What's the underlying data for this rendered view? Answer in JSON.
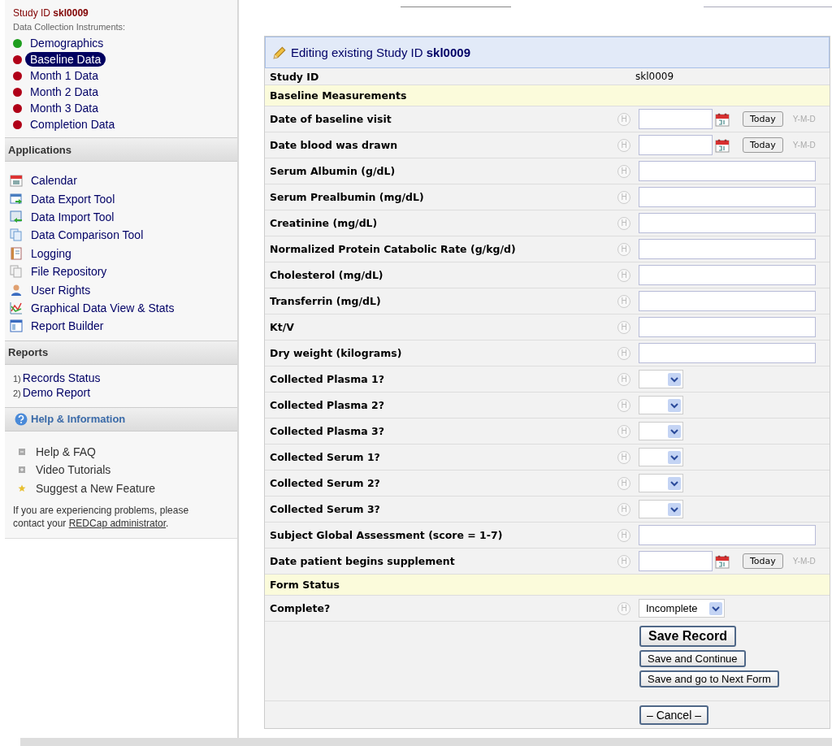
{
  "sidebar": {
    "study_id": "Study ID **skl0009**",
    "instruments_heading": "Data Collection Instruments:",
    "instruments": [
      {
        "label": "Demographics",
        "color": "#1e9e1e",
        "selected": false
      },
      {
        "label": "Baseline Data",
        "color": "#b00018",
        "selected": true
      },
      {
        "label": "Month 1 Data",
        "color": "#b00018",
        "selected": false
      },
      {
        "label": "Month 2 Data",
        "color": "#b00018",
        "selected": false
      },
      {
        "label": "Month 3 Data",
        "color": "#b00018",
        "selected": false
      },
      {
        "label": "Completion Data",
        "color": "#b00018",
        "selected": false
      }
    ],
    "applications": {
      "title": "Applications",
      "items": [
        "Calendar",
        "Data Export Tool",
        "Data Import Tool",
        "Data Comparison Tool",
        "Logging",
        "File Repository",
        "User Rights",
        "Graphical Data View & Stats",
        "Report Builder"
      ]
    },
    "reports": {
      "title": "Reports",
      "items": [
        {
          "number": "1)",
          "label": "Records Status"
        },
        {
          "number": "2)",
          "label": "Demo Report"
        }
      ]
    },
    "help": {
      "title": "Help & Information",
      "items": [
        "Help & FAQ",
        "Video Tutorials",
        "Suggest a New Feature"
      ],
      "note": "If you are experiencing problems, please contact your",
      "note_link": "REDCap administrator",
      "note_end": "."
    }
  },
  "form": {
    "title": "Editing existing Study ID **skl0009**",
    "study_id_label": "Study ID",
    "study_id_value": "skl0009",
    "sections": [
      {
        "title": "Baseline Measurements",
        "fields": [
          {
            "label": "Date of baseline visit",
            "kind": "date",
            "hint": "H",
            "button": "Today",
            "format": "Y-M-D"
          },
          {
            "label": "Date blood was drawn",
            "kind": "date",
            "hint": "H",
            "button": "Today",
            "format": "Y-M-D"
          },
          {
            "label": "Serum Albumin (g/dL)",
            "kind": "text",
            "hint": "H"
          },
          {
            "label": "Serum Prealbumin (mg/dL)",
            "kind": "text",
            "hint": "H"
          },
          {
            "label": "Creatinine (mg/dL)",
            "kind": "text",
            "hint": "H"
          },
          {
            "label": "Normalized Protein Catabolic Rate (g/kg/d)",
            "kind": "text",
            "hint": "H"
          },
          {
            "label": "Cholesterol (mg/dL)",
            "kind": "text",
            "hint": "H"
          },
          {
            "label": "Transferrin (mg/dL)",
            "kind": "text",
            "hint": "H"
          },
          {
            "label": "Kt/V",
            "kind": "text",
            "hint": "H"
          },
          {
            "label": "Dry weight (kilograms)",
            "kind": "text",
            "hint": "H"
          },
          {
            "label": "Collected Plasma 1?",
            "kind": "select",
            "hint": "H"
          },
          {
            "label": "Collected Plasma 2?",
            "kind": "select",
            "hint": "H"
          },
          {
            "label": "Collected Plasma 3?",
            "kind": "select",
            "hint": "H"
          },
          {
            "label": "Collected Serum 1?",
            "kind": "select",
            "hint": "H"
          },
          {
            "label": "Collected Serum 2?",
            "kind": "select",
            "hint": "H"
          },
          {
            "label": "Collected Serum 3?",
            "kind": "select",
            "hint": "H"
          },
          {
            "label": "Subject Global Assessment (score = 1-7)",
            "kind": "text",
            "hint": "H"
          },
          {
            "label": "Date patient begins supplement",
            "kind": "date",
            "hint": "H",
            "button": "Today",
            "format": "Y-M-D"
          }
        ]
      },
      {
        "title": "Form Status",
        "fields": [
          {
            "label": "Complete?",
            "kind": "select",
            "hint": "H",
            "value": "Incomplete"
          }
        ]
      }
    ],
    "buttons": [
      "Save Record",
      "Save and Continue",
      "Save and go to Next Form"
    ],
    "cancel": "– Cancel –"
  }
}
